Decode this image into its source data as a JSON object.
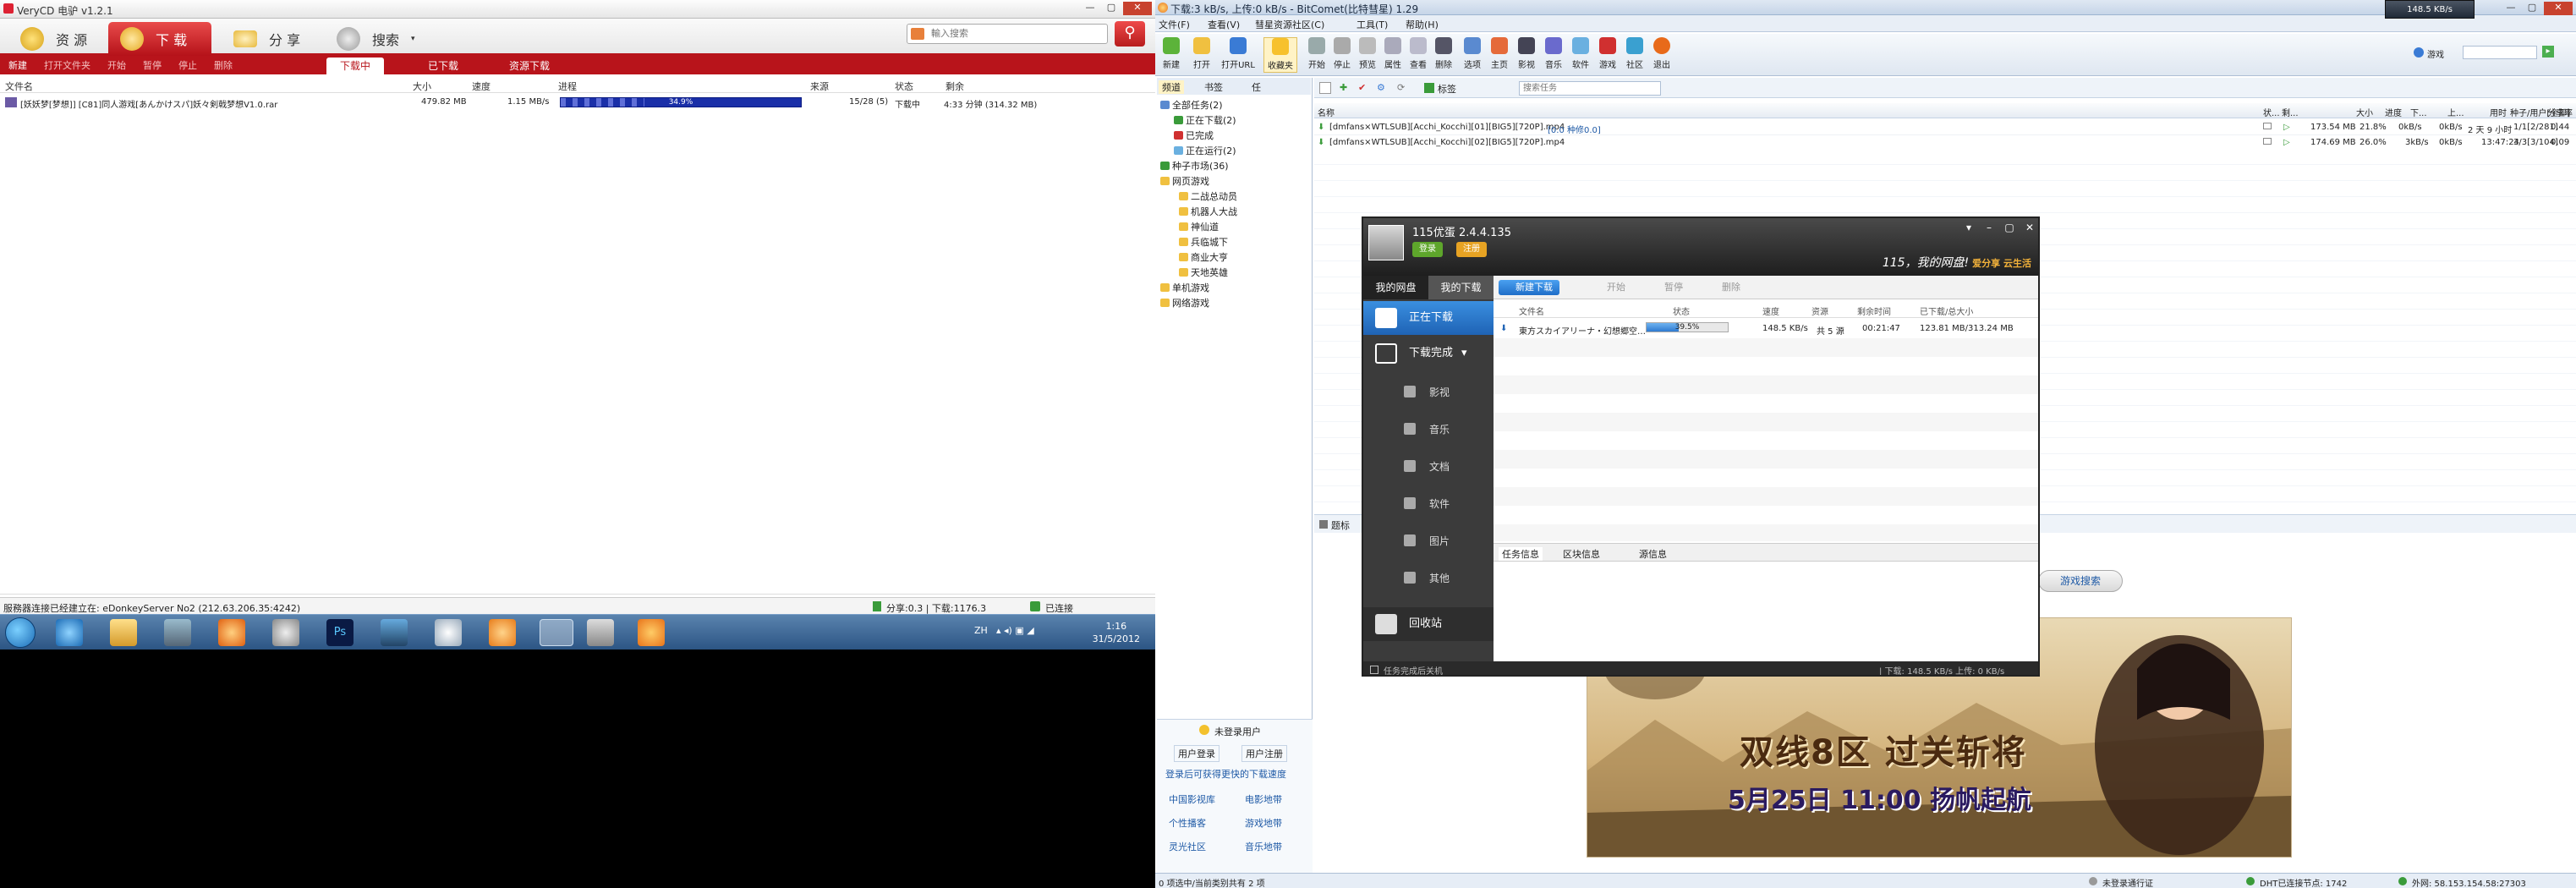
{
  "verycd": {
    "title": "VeryCD 电驴 v1.2.1",
    "nav": [
      "资 源",
      "下 载",
      "分 享",
      "搜索"
    ],
    "search_placeholder": "輸入搜索",
    "toolbar": [
      "新建",
      "打开文件夹",
      "开始",
      "暂停",
      "停止",
      "删除"
    ],
    "subtabs": [
      "下载中",
      "已下载",
      "资源下载"
    ],
    "columns": [
      "文件名",
      "大小",
      "速度",
      "进程",
      "来源",
      "状态",
      "剩余"
    ],
    "row": {
      "name": "[妖妖梦[梦想]] [C81]同人游戏[あんかけスパ]妖々剣戟梦想V1.0.rar",
      "size": "479.82 MB",
      "speed": "1.15 MB/s",
      "progress_label": "34.9%",
      "progress": 0.349,
      "sources": "15/28 (5)",
      "status": "下载中",
      "remaining": "4:33 分钟 (314.32 MB)"
    },
    "status_left": "服務器连接已经建立在: eDonkeyServer No2 (212.63.206.35:4242)",
    "status_share": "分享:0.3 | 下载:1176.3",
    "status_conn": "已连接",
    "clock_time": "1:16",
    "clock_date": "31/5/2012",
    "tray_lang": "ZH"
  },
  "bitcomet": {
    "title": "下载:3 kB/s, 上传:0 kB/s - BitComet(比特彗星) 1.29",
    "speed_float": "148.5 KB/s",
    "menu": [
      "文件(F)",
      "查看(V)",
      "彗星资源社区(C)",
      "工具(T)",
      "帮助(H)"
    ],
    "toolbar": [
      "新建",
      "打开",
      "打开URL",
      "收藏夹",
      "开始",
      "停止",
      "预览",
      "属性",
      "查看",
      "删除",
      "选项",
      "主页",
      "影视",
      "音乐",
      "软件",
      "游戏",
      "社区",
      "退出"
    ],
    "search_combo": "游戏",
    "tree_tabs": [
      "频道",
      "书签",
      "任"
    ],
    "tree": [
      "全部任务(2)",
      "正在下载(2)",
      "已完成",
      "正在运行(2)",
      "种子市场(36)",
      "网页游戏",
      "二战总动员",
      "机器人大战",
      "神仙道",
      "兵临城下",
      "商业大亨",
      "天地英雄",
      "单机游戏",
      "网络游戏"
    ],
    "rtools": [
      "标签"
    ],
    "search_placeholder": "搜索任务",
    "columns": [
      "名称",
      "状...",
      "剩...",
      "大小",
      "进度",
      "下...",
      "上...",
      "用时",
      "种子/用户[全部]",
      "分享率"
    ],
    "tasks": [
      {
        "name": "[dmfans×WTLSUB][Acchi_Kocchi][01][BIG5][720P].mp4",
        "note": "[0.0 种修0.0]",
        "size": "173.54 MB",
        "progress": "21.8%",
        "down": "0kB/s",
        "up": "0kB/s",
        "time": "2 天 9 小时",
        "peers": "1/1[2/281]",
        "ratio": "0.44"
      },
      {
        "name": "[dmfans×WTLSUB][Acchi_Kocchi][02][BIG5][720P].mp4",
        "note": "",
        "size": "174.69 MB",
        "progress": "26.0%",
        "down": "3kB/s",
        "up": "0kB/s",
        "time": "13:47:24",
        "peers": "3/3[3/104]",
        "ratio": "0.09"
      }
    ],
    "info_tab": "题标",
    "game_search_btn": "游戏搜索",
    "banner_line1": "双线8区 过关斩将",
    "banner_line2": "5月25日 11:00 扬帆起航",
    "login_title": "未登录用户",
    "login_btns": [
      "用户登录",
      "用户注册"
    ],
    "login_hint": "登录后可获得更快的下载速度",
    "links": [
      "中国影视库",
      "电影地带",
      "个性播客",
      "游戏地带",
      "灵光社区",
      "音乐地带"
    ],
    "status_left": "0 项选中/当前类别共有 2 项",
    "status_user": "未登录通行证",
    "status_dht": "DHT已连接节点: 1742",
    "status_ip": "外网: 58.153.154.58:27303"
  },
  "yo115": {
    "title": "115优蛋 2.4.4.135",
    "login": "登录",
    "register": "注册",
    "slogan": "115，我的网盘!",
    "slogan_sub": "爱分享 云生活",
    "side_tabs": [
      "我的网盘",
      "我的下载"
    ],
    "side_items": [
      "正在下载",
      "下载完成"
    ],
    "sub_items": [
      "影视",
      "音乐",
      "文档",
      "软件",
      "图片",
      "其他"
    ],
    "trash": "回收站",
    "toolbar": [
      "新建下载",
      "开始",
      "暂停",
      "删除"
    ],
    "columns": [
      "文件名",
      "状态",
      "速度",
      "资源",
      "剩余时间",
      "已下载/总大小"
    ],
    "row": {
      "name": "東方スカイアリーナ・幻想郷空…",
      "progress_label": "39.5%",
      "progress": 0.395,
      "speed": "148.5 KB/s",
      "sources": "共 5 源",
      "remaining": "00:21:47",
      "size": "123.81 MB/313.24 MB"
    },
    "detail_tabs": [
      "任务信息",
      "区块信息",
      "源信息"
    ],
    "footer_left": "任务完成后关机",
    "footer_right": "| 下载: 148.5 KB/s  上传: 0 KB/s"
  },
  "colors": {
    "verycd_red": "#b8141b",
    "bitcomet_blue": "#dfe7f1",
    "yo_dark": "#2a2a2a",
    "yo_blue": "#1f63b5"
  }
}
